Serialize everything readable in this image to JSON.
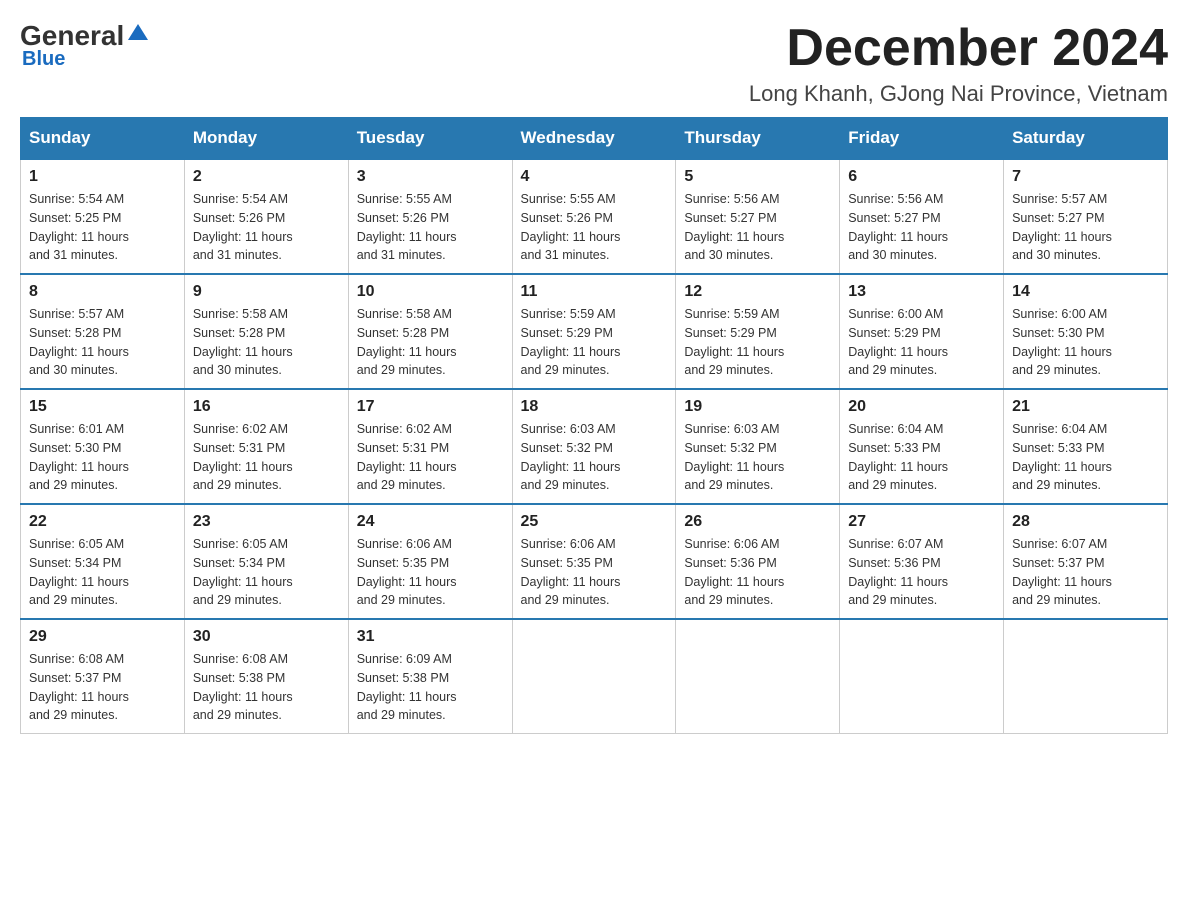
{
  "header": {
    "logo_general": "General",
    "logo_blue": "Blue",
    "main_title": "December 2024",
    "subtitle": "Long Khanh, GJong Nai Province, Vietnam"
  },
  "days_of_week": [
    "Sunday",
    "Monday",
    "Tuesday",
    "Wednesday",
    "Thursday",
    "Friday",
    "Saturday"
  ],
  "weeks": [
    [
      {
        "day": "1",
        "sunrise": "5:54 AM",
        "sunset": "5:25 PM",
        "daylight": "11 hours and 31 minutes."
      },
      {
        "day": "2",
        "sunrise": "5:54 AM",
        "sunset": "5:26 PM",
        "daylight": "11 hours and 31 minutes."
      },
      {
        "day": "3",
        "sunrise": "5:55 AM",
        "sunset": "5:26 PM",
        "daylight": "11 hours and 31 minutes."
      },
      {
        "day": "4",
        "sunrise": "5:55 AM",
        "sunset": "5:26 PM",
        "daylight": "11 hours and 31 minutes."
      },
      {
        "day": "5",
        "sunrise": "5:56 AM",
        "sunset": "5:27 PM",
        "daylight": "11 hours and 30 minutes."
      },
      {
        "day": "6",
        "sunrise": "5:56 AM",
        "sunset": "5:27 PM",
        "daylight": "11 hours and 30 minutes."
      },
      {
        "day": "7",
        "sunrise": "5:57 AM",
        "sunset": "5:27 PM",
        "daylight": "11 hours and 30 minutes."
      }
    ],
    [
      {
        "day": "8",
        "sunrise": "5:57 AM",
        "sunset": "5:28 PM",
        "daylight": "11 hours and 30 minutes."
      },
      {
        "day": "9",
        "sunrise": "5:58 AM",
        "sunset": "5:28 PM",
        "daylight": "11 hours and 30 minutes."
      },
      {
        "day": "10",
        "sunrise": "5:58 AM",
        "sunset": "5:28 PM",
        "daylight": "11 hours and 29 minutes."
      },
      {
        "day": "11",
        "sunrise": "5:59 AM",
        "sunset": "5:29 PM",
        "daylight": "11 hours and 29 minutes."
      },
      {
        "day": "12",
        "sunrise": "5:59 AM",
        "sunset": "5:29 PM",
        "daylight": "11 hours and 29 minutes."
      },
      {
        "day": "13",
        "sunrise": "6:00 AM",
        "sunset": "5:29 PM",
        "daylight": "11 hours and 29 minutes."
      },
      {
        "day": "14",
        "sunrise": "6:00 AM",
        "sunset": "5:30 PM",
        "daylight": "11 hours and 29 minutes."
      }
    ],
    [
      {
        "day": "15",
        "sunrise": "6:01 AM",
        "sunset": "5:30 PM",
        "daylight": "11 hours and 29 minutes."
      },
      {
        "day": "16",
        "sunrise": "6:02 AM",
        "sunset": "5:31 PM",
        "daylight": "11 hours and 29 minutes."
      },
      {
        "day": "17",
        "sunrise": "6:02 AM",
        "sunset": "5:31 PM",
        "daylight": "11 hours and 29 minutes."
      },
      {
        "day": "18",
        "sunrise": "6:03 AM",
        "sunset": "5:32 PM",
        "daylight": "11 hours and 29 minutes."
      },
      {
        "day": "19",
        "sunrise": "6:03 AM",
        "sunset": "5:32 PM",
        "daylight": "11 hours and 29 minutes."
      },
      {
        "day": "20",
        "sunrise": "6:04 AM",
        "sunset": "5:33 PM",
        "daylight": "11 hours and 29 minutes."
      },
      {
        "day": "21",
        "sunrise": "6:04 AM",
        "sunset": "5:33 PM",
        "daylight": "11 hours and 29 minutes."
      }
    ],
    [
      {
        "day": "22",
        "sunrise": "6:05 AM",
        "sunset": "5:34 PM",
        "daylight": "11 hours and 29 minutes."
      },
      {
        "day": "23",
        "sunrise": "6:05 AM",
        "sunset": "5:34 PM",
        "daylight": "11 hours and 29 minutes."
      },
      {
        "day": "24",
        "sunrise": "6:06 AM",
        "sunset": "5:35 PM",
        "daylight": "11 hours and 29 minutes."
      },
      {
        "day": "25",
        "sunrise": "6:06 AM",
        "sunset": "5:35 PM",
        "daylight": "11 hours and 29 minutes."
      },
      {
        "day": "26",
        "sunrise": "6:06 AM",
        "sunset": "5:36 PM",
        "daylight": "11 hours and 29 minutes."
      },
      {
        "day": "27",
        "sunrise": "6:07 AM",
        "sunset": "5:36 PM",
        "daylight": "11 hours and 29 minutes."
      },
      {
        "day": "28",
        "sunrise": "6:07 AM",
        "sunset": "5:37 PM",
        "daylight": "11 hours and 29 minutes."
      }
    ],
    [
      {
        "day": "29",
        "sunrise": "6:08 AM",
        "sunset": "5:37 PM",
        "daylight": "11 hours and 29 minutes."
      },
      {
        "day": "30",
        "sunrise": "6:08 AM",
        "sunset": "5:38 PM",
        "daylight": "11 hours and 29 minutes."
      },
      {
        "day": "31",
        "sunrise": "6:09 AM",
        "sunset": "5:38 PM",
        "daylight": "11 hours and 29 minutes."
      },
      null,
      null,
      null,
      null
    ]
  ],
  "labels": {
    "sunrise_prefix": "Sunrise: ",
    "sunset_prefix": "Sunset: ",
    "daylight_prefix": "Daylight: "
  }
}
